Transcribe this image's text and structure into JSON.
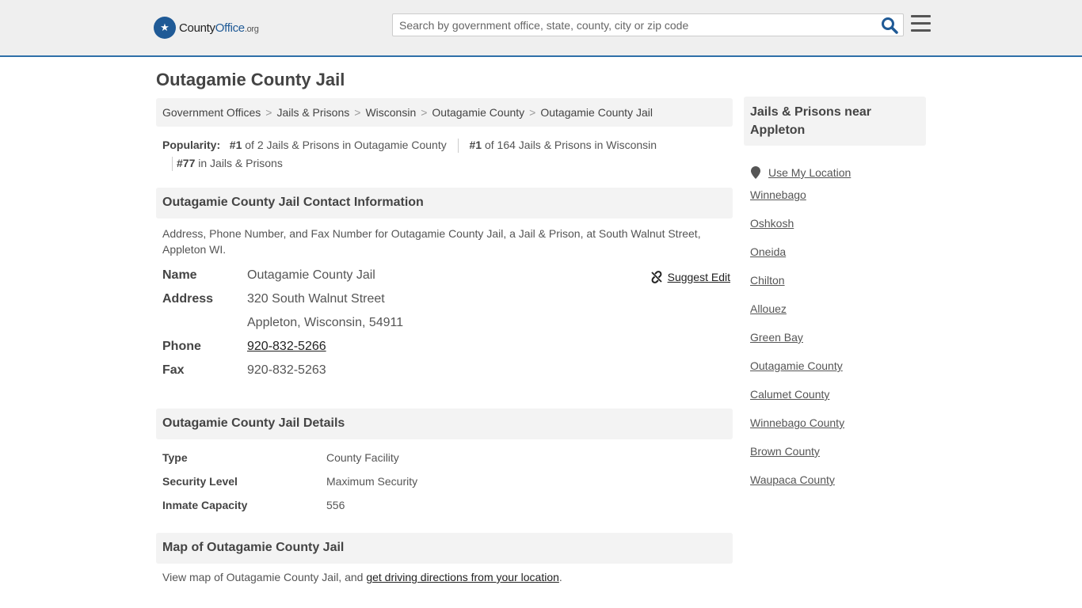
{
  "header": {
    "logo": {
      "brand": "County",
      "brand2": "Office",
      "tld": ".org"
    },
    "search_placeholder": "Search by government office, state, county, city or zip code"
  },
  "page": {
    "title": "Outagamie County Jail"
  },
  "breadcrumb": [
    "Government Offices",
    "Jails & Prisons",
    "Wisconsin",
    "Outagamie County",
    "Outagamie County Jail"
  ],
  "popularity": {
    "label": "Popularity:",
    "r1_rank": "#1",
    "r1_text": "of 2 Jails & Prisons in Outagamie County",
    "r2_rank": "#1",
    "r2_text": "of 164 Jails & Prisons in Wisconsin",
    "r3_rank": "#77",
    "r3_text": "in Jails & Prisons"
  },
  "contact": {
    "heading": "Outagamie County Jail Contact Information",
    "description": "Address, Phone Number, and Fax Number for Outagamie County Jail, a Jail & Prison, at South Walnut Street, Appleton WI.",
    "suggest_edit": "Suggest Edit",
    "name_label": "Name",
    "name": "Outagamie County Jail",
    "address_label": "Address",
    "address1": "320 South Walnut Street",
    "address2": "Appleton, Wisconsin, 54911",
    "phone_label": "Phone",
    "phone": "920-832-5266",
    "fax_label": "Fax",
    "fax": "920-832-5263"
  },
  "details": {
    "heading": "Outagamie County Jail Details",
    "rows": [
      {
        "label": "Type",
        "value": "County Facility"
      },
      {
        "label": "Security Level",
        "value": "Maximum Security"
      },
      {
        "label": "Inmate Capacity",
        "value": "556"
      }
    ]
  },
  "map": {
    "heading": "Map of Outagamie County Jail",
    "text_before": "View map of Outagamie County Jail, and ",
    "link": "get driving directions from your location",
    "text_after": "."
  },
  "sidebar": {
    "heading": "Jails & Prisons near Appleton",
    "use_location": "Use My Location",
    "items": [
      "Winnebago",
      "Oshkosh",
      "Oneida",
      "Chilton",
      "Allouez",
      "Green Bay",
      "Outagamie County",
      "Calumet County",
      "Winnebago County",
      "Brown County",
      "Waupaca County"
    ]
  },
  "colors": {
    "accent": "#2f6fa8",
    "logo": "#1f5a96",
    "search_icon": "#1f5a96"
  }
}
